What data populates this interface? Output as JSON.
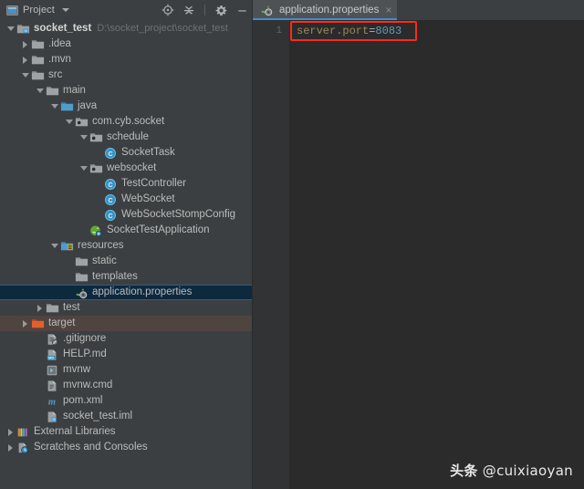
{
  "tool_window": {
    "title": "Project",
    "icon": "project-view-icon",
    "dropdown_icon": "chevron-down-icon",
    "toolbar": [
      {
        "name": "select-opened-file-icon",
        "tooltip": "Select Opened File"
      },
      {
        "name": "collapse-all-icon",
        "tooltip": "Collapse All"
      },
      {
        "name": "settings-gear-icon",
        "tooltip": "Settings"
      },
      {
        "name": "hide-icon",
        "tooltip": "Hide"
      }
    ]
  },
  "tree": [
    {
      "label": "socket_test",
      "hint": "D:\\socket_project\\socket_test",
      "depth": 0,
      "arrow": "expanded",
      "icon": "module-folder-icon",
      "bold": true,
      "state": "normal"
    },
    {
      "label": ".idea",
      "hint": "",
      "depth": 1,
      "arrow": "collapsed",
      "icon": "folder-icon",
      "bold": false,
      "state": "normal"
    },
    {
      "label": ".mvn",
      "hint": "",
      "depth": 1,
      "arrow": "collapsed",
      "icon": "folder-icon",
      "bold": false,
      "state": "normal"
    },
    {
      "label": "src",
      "hint": "",
      "depth": 1,
      "arrow": "expanded",
      "icon": "folder-icon",
      "bold": false,
      "state": "normal"
    },
    {
      "label": "main",
      "hint": "",
      "depth": 2,
      "arrow": "expanded",
      "icon": "folder-icon",
      "bold": false,
      "state": "normal"
    },
    {
      "label": "java",
      "hint": "",
      "depth": 3,
      "arrow": "expanded",
      "icon": "source-root-icon",
      "bold": false,
      "state": "normal"
    },
    {
      "label": "com.cyb.socket",
      "hint": "",
      "depth": 4,
      "arrow": "expanded",
      "icon": "package-icon",
      "bold": false,
      "state": "normal"
    },
    {
      "label": "schedule",
      "hint": "",
      "depth": 5,
      "arrow": "expanded",
      "icon": "package-icon",
      "bold": false,
      "state": "normal"
    },
    {
      "label": "SocketTask",
      "hint": "",
      "depth": 6,
      "arrow": "none",
      "icon": "java-class-icon",
      "bold": false,
      "state": "normal"
    },
    {
      "label": "websocket",
      "hint": "",
      "depth": 5,
      "arrow": "expanded",
      "icon": "package-icon",
      "bold": false,
      "state": "normal"
    },
    {
      "label": "TestController",
      "hint": "",
      "depth": 6,
      "arrow": "none",
      "icon": "java-class-icon",
      "bold": false,
      "state": "normal"
    },
    {
      "label": "WebSocket",
      "hint": "",
      "depth": 6,
      "arrow": "none",
      "icon": "java-class-icon",
      "bold": false,
      "state": "normal"
    },
    {
      "label": "WebSocketStompConfig",
      "hint": "",
      "depth": 6,
      "arrow": "none",
      "icon": "java-class-icon",
      "bold": false,
      "state": "normal"
    },
    {
      "label": "SocketTestApplication",
      "hint": "",
      "depth": 5,
      "arrow": "none",
      "icon": "spring-boot-class-icon",
      "bold": false,
      "state": "normal"
    },
    {
      "label": "resources",
      "hint": "",
      "depth": 3,
      "arrow": "expanded",
      "icon": "resource-root-icon",
      "bold": false,
      "state": "normal"
    },
    {
      "label": "static",
      "hint": "",
      "depth": 4,
      "arrow": "none",
      "icon": "folder-icon",
      "bold": false,
      "state": "normal"
    },
    {
      "label": "templates",
      "hint": "",
      "depth": 4,
      "arrow": "none",
      "icon": "folder-icon",
      "bold": false,
      "state": "normal"
    },
    {
      "label": "application.properties",
      "hint": "",
      "depth": 4,
      "arrow": "none",
      "icon": "spring-properties-icon",
      "bold": false,
      "state": "selected"
    },
    {
      "label": "test",
      "hint": "",
      "depth": 2,
      "arrow": "collapsed",
      "icon": "folder-icon",
      "bold": false,
      "state": "normal"
    },
    {
      "label": "target",
      "hint": "",
      "depth": 1,
      "arrow": "collapsed",
      "icon": "excluded-folder-icon",
      "bold": false,
      "state": "hovered"
    },
    {
      "label": ".gitignore",
      "hint": "",
      "depth": 2,
      "arrow": "none",
      "icon": "gitignore-file-icon",
      "bold": false,
      "state": "normal"
    },
    {
      "label": "HELP.md",
      "hint": "",
      "depth": 2,
      "arrow": "none",
      "icon": "markdown-file-icon",
      "bold": false,
      "state": "normal"
    },
    {
      "label": "mvnw",
      "hint": "",
      "depth": 2,
      "arrow": "none",
      "icon": "script-file-icon",
      "bold": false,
      "state": "normal"
    },
    {
      "label": "mvnw.cmd",
      "hint": "",
      "depth": 2,
      "arrow": "none",
      "icon": "cmd-file-icon",
      "bold": false,
      "state": "normal"
    },
    {
      "label": "pom.xml",
      "hint": "",
      "depth": 2,
      "arrow": "none",
      "icon": "maven-pom-icon",
      "bold": false,
      "state": "normal"
    },
    {
      "label": "socket_test.iml",
      "hint": "",
      "depth": 2,
      "arrow": "none",
      "icon": "iml-module-file-icon",
      "bold": false,
      "state": "normal"
    },
    {
      "label": "External Libraries",
      "hint": "",
      "depth": 0,
      "arrow": "collapsed",
      "icon": "external-libraries-icon",
      "bold": false,
      "state": "normal"
    },
    {
      "label": "Scratches and Consoles",
      "hint": "",
      "depth": 0,
      "arrow": "collapsed",
      "icon": "scratches-icon",
      "bold": false,
      "state": "normal"
    }
  ],
  "editor": {
    "tabs": [
      {
        "label": "application.properties",
        "icon": "spring-properties-icon",
        "close_icon": "close-icon",
        "active": true
      }
    ],
    "lines": [
      {
        "number": "1",
        "key": "server.port",
        "separator": "=",
        "value": "8083"
      }
    ],
    "annotation": {
      "name": "red-highlight-box",
      "color": "#fc2a1c"
    }
  },
  "watermark": {
    "cn": "头条",
    "handle": "@cuixiaoyan"
  },
  "colors": {
    "panel_bg": "#3c3f41",
    "editor_bg": "#2b2b2b",
    "gutter_bg": "#313335",
    "selection_bg": "#0d293e",
    "selection_border": "#2a5d8f",
    "hover_bg": "#4e4440",
    "tab_active_underline": "#4a88c7",
    "key_color": "#9e8855",
    "value_color": "#6897bb",
    "annotation_red": "#fc2a1c"
  }
}
